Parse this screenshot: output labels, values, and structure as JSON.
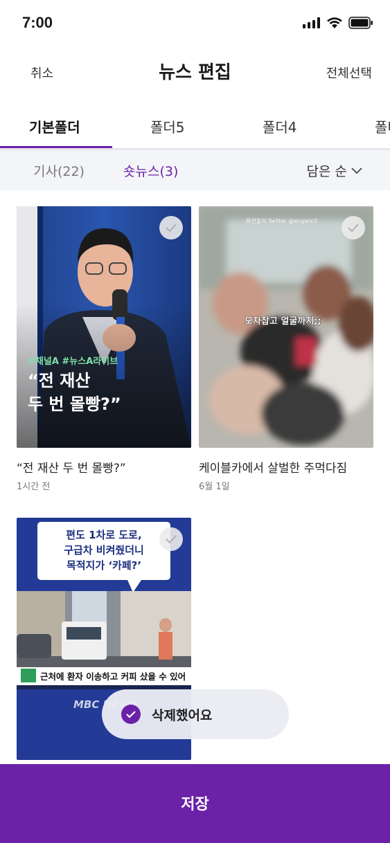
{
  "status": {
    "time": "7:00"
  },
  "header": {
    "cancel": "취소",
    "title": "뉴스 편집",
    "select_all": "전체선택"
  },
  "tabs": [
    {
      "label": "기본폴더",
      "active": true
    },
    {
      "label": "폴더5"
    },
    {
      "label": "폴더4"
    },
    {
      "label": "폴더"
    }
  ],
  "subtabs": [
    {
      "label": "기사(22)"
    },
    {
      "label": "숏뉴스(3)",
      "active": true
    }
  ],
  "sort": {
    "label": "담은 순"
  },
  "cards": [
    {
      "title": "“전 재산 두 번 몰빵?”",
      "date": "1시간 전",
      "overlay_tag": "#채널A #뉴스A라이브",
      "overlay_line1": "“전 재산",
      "overlay_line2": "두 번 몰빵?”"
    },
    {
      "title": "케이블카에서 살벌한 주먹다짐",
      "date": "6월 1일",
      "watermark": "화면출처 Twitter @engwin3",
      "caption": "모자잡고 얼굴까지;;"
    },
    {
      "bubble_line1": "편도 1차로 도로,",
      "bubble_line2": "구급차 비켜줬더니",
      "bubble_line3": "목적지가 ‘카페?’",
      "news_caption": "근처에 환자 이송하고 커피 샀을 수 있어",
      "logo": "MBC NEWS"
    }
  ],
  "toast": {
    "message": "삭제했어요"
  },
  "save": {
    "label": "저장"
  },
  "colors": {
    "accent": "#6b21a8",
    "subbar_bg": "#f4f5f8"
  }
}
